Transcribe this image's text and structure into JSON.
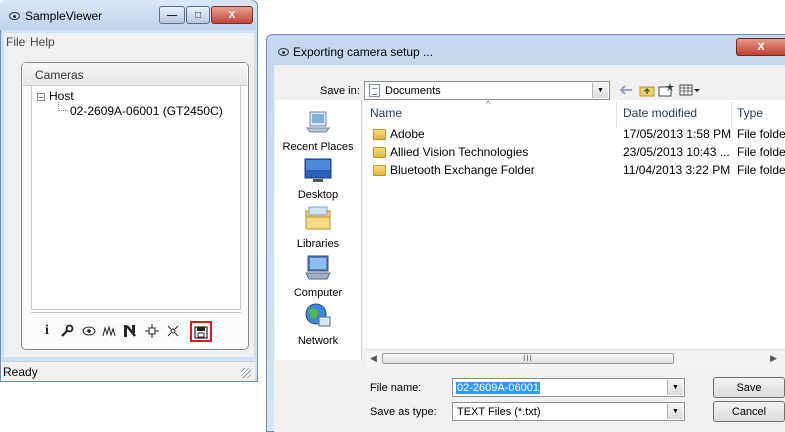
{
  "sample_viewer": {
    "title": "SampleViewer",
    "menu": [
      "File",
      "Help"
    ],
    "cameras_label": "Cameras",
    "tree": {
      "root": "Host",
      "camera": "02-2609A-06001 (GT2450C)"
    },
    "toolbar_icons": [
      "info-icon",
      "wrench-icon",
      "eye-icon",
      "histogram-icon",
      "register-icon",
      "io-icon",
      "wireless-icon",
      "export-settings-icon"
    ],
    "status": "Ready",
    "controls": {
      "minimize": "—",
      "maximize": "□",
      "close": "X"
    }
  },
  "dialog": {
    "title": "Exporting camera setup ...",
    "close": "X",
    "save_in_label": "Save in:",
    "save_in_value": "Documents",
    "places": [
      "Recent Places",
      "Desktop",
      "Libraries",
      "Computer",
      "Network"
    ],
    "columns": {
      "name": "Name",
      "date": "Date modified",
      "type": "Type"
    },
    "files": [
      {
        "name": "Adobe",
        "date": "17/05/2013 1:58 PM",
        "type": "File folder"
      },
      {
        "name": "Allied Vision Technologies",
        "date": "23/05/2013 10:43 ...",
        "type": "File folder"
      },
      {
        "name": "Bluetooth Exchange Folder",
        "date": "11/04/2013 3:22 PM",
        "type": "File folder"
      }
    ],
    "scroll_grip": "III",
    "file_name_label": "File name:",
    "file_name_value": "02-2609A-06001",
    "save_type_label": "Save as type:",
    "save_type_value": "TEXT Files (*.txt)",
    "save_button": "Save",
    "cancel_button": "Cancel"
  },
  "colors": {
    "selection": "#3399ff",
    "highlight_box": "#e01a1a",
    "close_button": "#c23f2f"
  }
}
